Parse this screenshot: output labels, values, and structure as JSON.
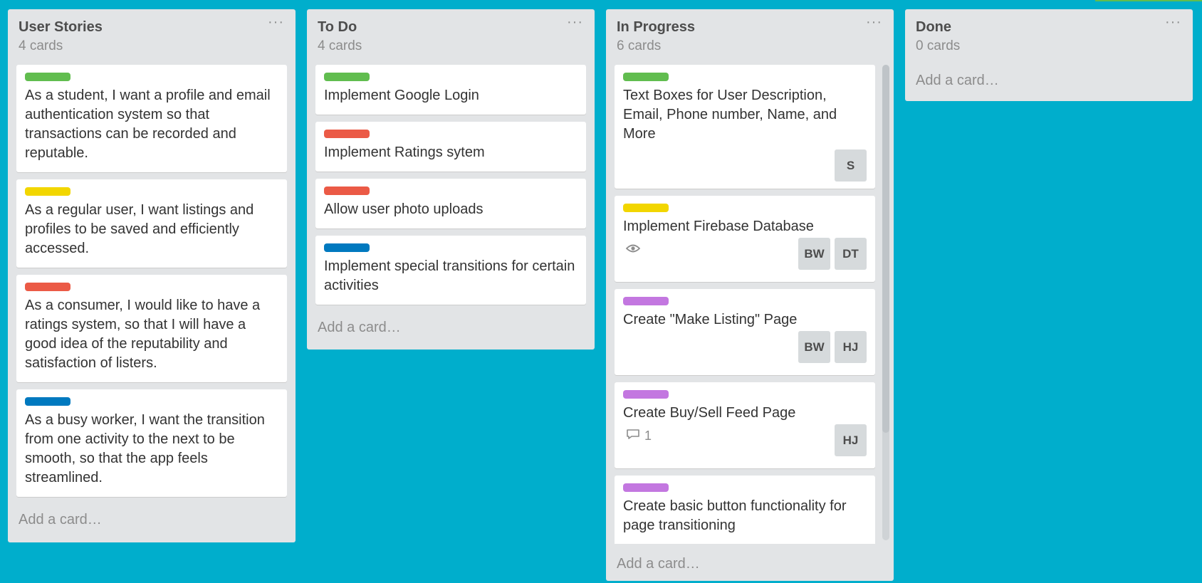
{
  "colors": {
    "green": "#61bd4f",
    "yellow": "#f2d600",
    "red": "#eb5a46",
    "blue": "#0079bf",
    "purple": "#c377e0",
    "board_bg": "#00aecc"
  },
  "lists": [
    {
      "title": "User Stories",
      "count": "4 cards",
      "add_card": "Add a card…",
      "cards": [
        {
          "label": "green",
          "title": "As a student, I want a profile and email authentication system so that transactions can be recorded and reputable."
        },
        {
          "label": "yellow",
          "title": "As a regular user, I want listings and profiles to be saved and efficiently accessed."
        },
        {
          "label": "red",
          "title": "As a consumer, I would like to have a ratings system, so that I will have a good idea of the reputability and satisfaction of listers."
        },
        {
          "label": "blue",
          "title": "As a busy worker, I want the transition from one activity to the next to be smooth, so that the app feels streamlined."
        }
      ]
    },
    {
      "title": "To Do",
      "count": "4 cards",
      "add_card": "Add a card…",
      "cards": [
        {
          "label": "green",
          "title": "Implement Google Login"
        },
        {
          "label": "red",
          "title": "Implement Ratings sytem"
        },
        {
          "label": "red",
          "title": "Allow user photo uploads"
        },
        {
          "label": "blue",
          "title": "Implement special transitions for certain activities"
        }
      ]
    },
    {
      "title": "In Progress",
      "count": "6 cards",
      "add_card": "Add a card…",
      "cards": [
        {
          "label": "green",
          "title": "Text Boxes for User Description, Email, Phone number, Name, and More",
          "members": [
            "S"
          ]
        },
        {
          "label": "yellow",
          "title": "Implement Firebase Database",
          "watch": true,
          "members": [
            "BW",
            "DT"
          ]
        },
        {
          "label": "purple",
          "title": "Create \"Make Listing\" Page",
          "members": [
            "BW",
            "HJ"
          ]
        },
        {
          "label": "purple",
          "title": "Create Buy/Sell Feed Page",
          "comments": "1",
          "members": [
            "HJ"
          ]
        },
        {
          "label": "purple",
          "title": "Create basic button functionality for page transitioning"
        }
      ]
    },
    {
      "title": "Done",
      "count": "0 cards",
      "add_card": "Add a card…",
      "cards": []
    }
  ]
}
